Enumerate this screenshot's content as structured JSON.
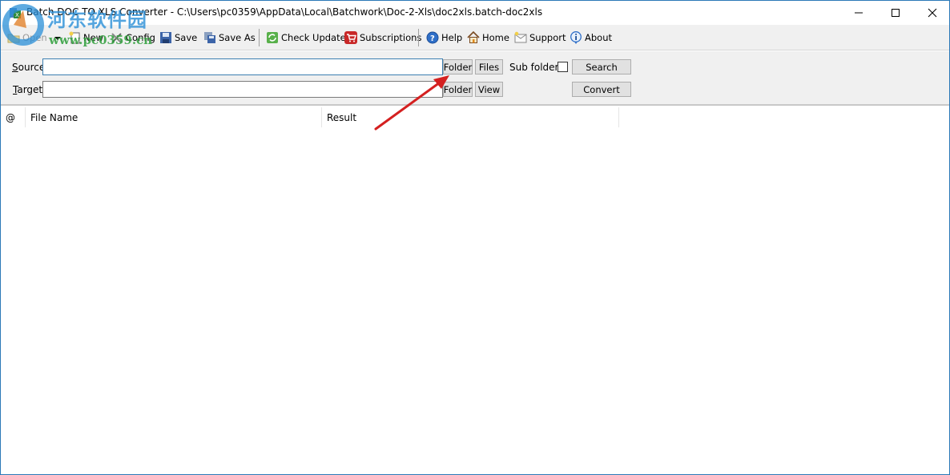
{
  "window": {
    "title": "Batch DOC TO XLS Converter - C:\\Users\\pc0359\\AppData\\Local\\Batchwork\\Doc-2-Xls\\doc2xls.batch-doc2xls",
    "controls": {
      "minimize": "minimize",
      "maximize": "maximize",
      "close": "close"
    }
  },
  "toolbar": {
    "items": [
      {
        "label": "Open",
        "icon": "folder-open-icon",
        "disabled": true
      },
      {
        "label": "New",
        "icon": "new-file-icon"
      },
      {
        "label": "Config",
        "icon": "tools-icon"
      },
      {
        "label": "Save",
        "icon": "floppy-disk-icon"
      },
      {
        "label": "Save As",
        "icon": "save-as-icon"
      },
      {
        "label": "Check Update",
        "icon": "refresh-icon"
      },
      {
        "label": "Subscriptions",
        "icon": "shopping-cart-icon"
      },
      {
        "label": "Help",
        "icon": "help-icon"
      },
      {
        "label": "Home",
        "icon": "home-icon"
      },
      {
        "label": "Support",
        "icon": "envelope-icon"
      },
      {
        "label": "About",
        "icon": "info-icon"
      }
    ]
  },
  "form": {
    "source": {
      "label_underlined": "S",
      "label_rest": "ource",
      "value": "",
      "placeholder": ""
    },
    "target": {
      "label_underlined": "T",
      "label_rest": "arget",
      "value": "",
      "placeholder": ""
    },
    "source_folder_btn": "Folder",
    "source_files_btn": "Files",
    "target_folder_btn": "Folder",
    "target_view_btn": "View",
    "subfolders_label": "Sub folders",
    "subfolders_checked": false,
    "search_btn": "Search",
    "convert_btn": "Convert"
  },
  "list": {
    "columns": [
      "@",
      "File Name",
      "Result"
    ],
    "rows": []
  },
  "watermark": {
    "cn_text": "河东软件园",
    "url": "www.pc0359.cn"
  },
  "colors": {
    "window_border": "#2b79b8",
    "toolbar_bg": "#f0f0f0",
    "focus_border": "#3c7fb1",
    "annotation_arrow": "#d42020"
  }
}
